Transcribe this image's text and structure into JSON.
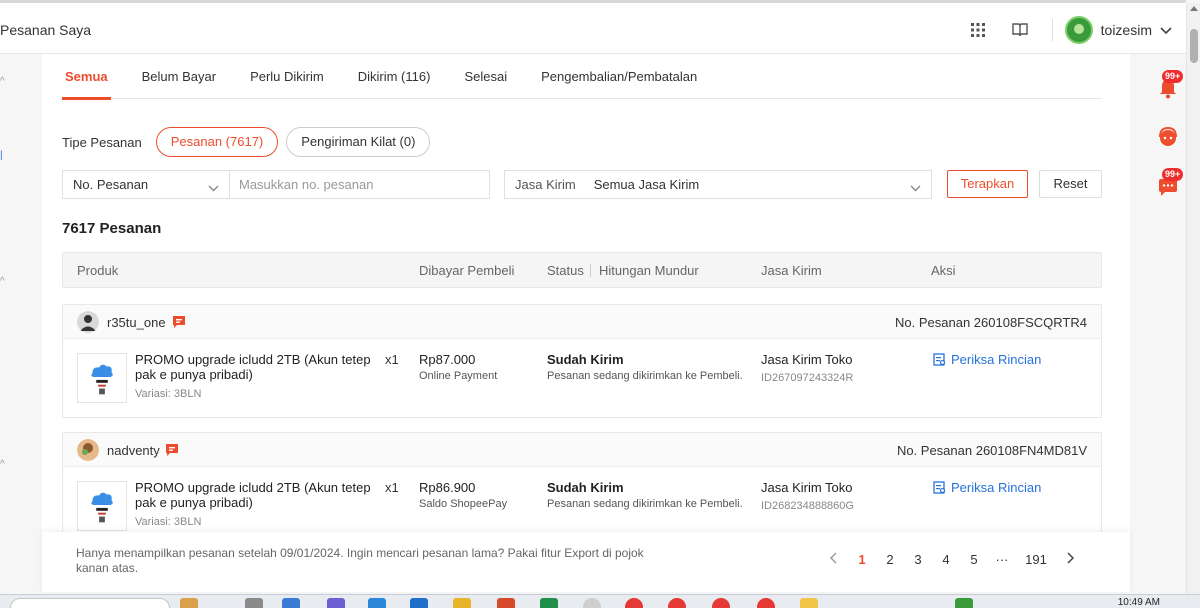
{
  "header": {
    "page_title": "Pesanan Saya",
    "user_name": "toizesim"
  },
  "tabs": [
    {
      "label": "Semua",
      "active": true
    },
    {
      "label": "Belum Bayar"
    },
    {
      "label": "Perlu Dikirim"
    },
    {
      "label": "Dikirim (116)"
    },
    {
      "label": "Selesai"
    },
    {
      "label": "Pengembalian/Pembatalan"
    }
  ],
  "order_type": {
    "label": "Tipe Pesanan",
    "options": [
      "Pesanan (7617)",
      "Pengiriman Kilat (0)"
    ]
  },
  "filters": {
    "search_by": "No. Pesanan",
    "search_placeholder": "Masukkan no. pesanan",
    "courier_label": "Jasa Kirim",
    "courier_value": "Semua Jasa Kirim",
    "apply_label": "Terapkan",
    "reset_label": "Reset"
  },
  "order_count": "7617 Pesanan",
  "table_headers": [
    "Produk",
    "Dibayar Pembeli",
    "Status",
    "Hitungan Mundur",
    "Jasa Kirim",
    "Aksi"
  ],
  "orders": [
    {
      "buyer": "r35tu_one",
      "order_no": "No. Pesanan 260108FSCQRTR4",
      "product_name": "PROMO upgrade icludd 2TB (Akun tetep pak e punya pribadi)",
      "qty": "x1",
      "variation": "Variasi: 3BLN",
      "price": "Rp87.000",
      "payment": "Online Payment",
      "status": "Sudah Kirim",
      "status_desc": "Pesanan sedang dikirimkan ke Pembeli.",
      "courier": "Jasa Kirim Toko",
      "tracking": "ID267097243324R",
      "action": "Periksa Rincian"
    },
    {
      "buyer": "nadventy",
      "order_no": "No. Pesanan 260108FN4MD81V",
      "product_name": "PROMO upgrade icludd 2TB (Akun tetep pak e punya pribadi)",
      "qty": "x1",
      "variation": "Variasi: 3BLN",
      "price": "Rp86.900",
      "payment": "Saldo ShopeePay",
      "status": "Sudah Kirim",
      "status_desc": "Pesanan sedang dikirimkan ke Pembeli.",
      "courier": "Jasa Kirim Toko",
      "tracking": "ID268234888860G",
      "action": "Periksa Rincian"
    }
  ],
  "footer": {
    "note": "Hanya menampilkan pesanan setelah 09/01/2024. Ingin mencari pesanan lama? Pakai fitur Export di pojok kanan atas.",
    "pages": [
      "1",
      "2",
      "3",
      "4",
      "5",
      "···",
      "191"
    ],
    "current_page": "1"
  },
  "side_badges": [
    "99+",
    "99+"
  ],
  "taskbar": {
    "time": "10:49 AM"
  },
  "colors": {
    "accent": "#ee4d2d",
    "link": "#2673dd"
  }
}
